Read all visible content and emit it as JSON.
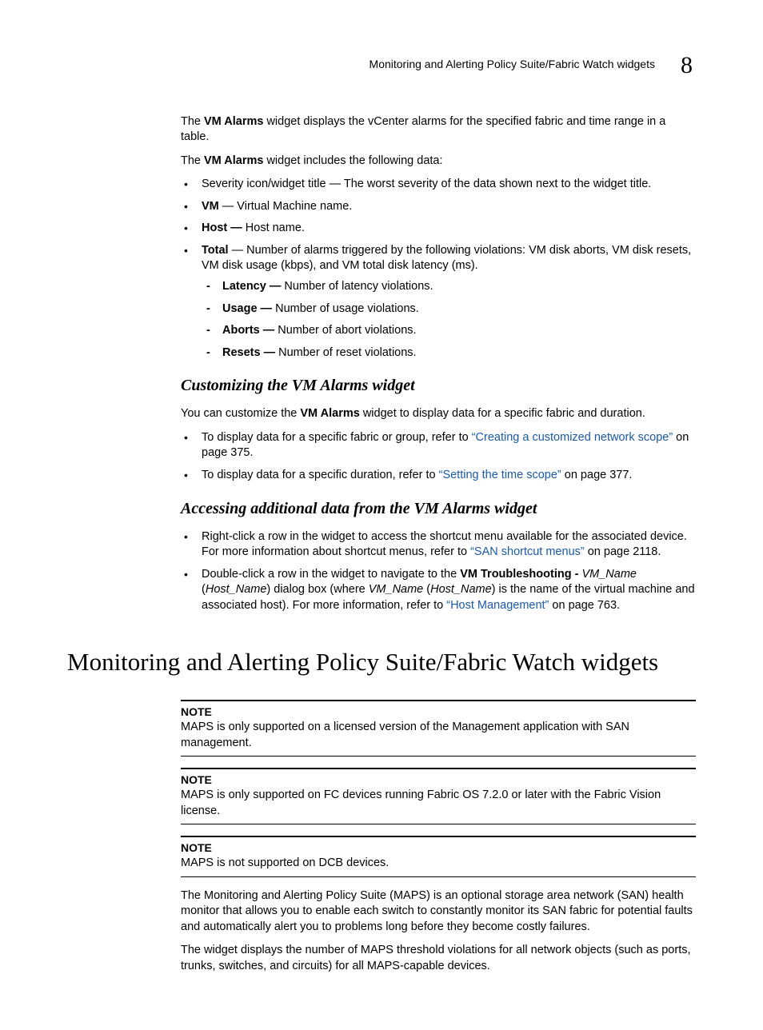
{
  "header": {
    "running_title": "Monitoring and Alerting Policy Suite/Fabric Watch widgets",
    "chapter_number": "8"
  },
  "intro": {
    "p1_pre": "The ",
    "p1_bold": "VM Alarms",
    "p1_post": " widget displays the vCenter alarms for the specified fabric and time range in a table.",
    "p2_pre": "The ",
    "p2_bold": "VM Alarms",
    "p2_post": " widget includes the following data:"
  },
  "data_list": {
    "severity": "Severity icon/widget title — The worst severity of the data shown next to the widget title.",
    "vm_bold": "VM",
    "vm_rest": " — Virtual Machine name.",
    "host_bold": "Host —",
    "host_rest": " Host name.",
    "total_bold": "Total",
    "total_rest": " — Number of alarms triggered by the following violations: VM disk aborts, VM disk resets, VM disk usage (kbps), and VM total disk latency (ms).",
    "sub": {
      "latency_bold": "Latency —",
      "latency_rest": " Number of latency violations.",
      "usage_bold": "Usage —",
      "usage_rest": " Number of usage violations.",
      "aborts_bold": "Aborts —",
      "aborts_rest": " Number of abort violations.",
      "resets_bold": "Resets —",
      "resets_rest": " Number of reset violations."
    }
  },
  "customizing": {
    "heading": "Customizing the VM Alarms widget",
    "intro_pre": "You can customize the ",
    "intro_bold": "VM Alarms",
    "intro_post": " widget to display data for a specific fabric and duration.",
    "b1_pre": "To display data for a specific fabric or group, refer to ",
    "b1_link": "“Creating a customized network scope”",
    "b1_post": " on page 375.",
    "b2_pre": "To display data for a specific duration, refer to ",
    "b2_link": "“Setting the time scope”",
    "b2_post": " on page 377."
  },
  "accessing": {
    "heading": "Accessing additional data from the VM Alarms widget",
    "b1_pre": "Right-click a row in the widget to access the shortcut menu available for the associated device. For more information about shortcut menus, refer to ",
    "b1_link": "“SAN shortcut menus”",
    "b1_post": " on page 2118.",
    "b2_a": "Double-click a row in the widget to navigate to the ",
    "b2_bold": "VM Troubleshooting - ",
    "b2_it1": "VM_Name",
    "b2_b": " (",
    "b2_it2": "Host_Name",
    "b2_c": ") dialog box (where ",
    "b2_it3": "VM_Name",
    "b2_d": " (",
    "b2_it4": "Host_Name",
    "b2_e": ") is the name of the virtual machine and associated host). For more information, refer to ",
    "b2_link": "“Host Management”",
    "b2_f": " on page 763."
  },
  "h1": "Monitoring and Alerting Policy Suite/Fabric Watch widgets",
  "notes": {
    "label": "NOTE",
    "n1": "MAPS is only supported on a licensed version of the Management application with SAN management.",
    "n2": "MAPS is only supported on FC devices running Fabric OS 7.2.0 or later with the Fabric Vision license.",
    "n3": "MAPS is not supported on DCB devices."
  },
  "maps_body": {
    "p1": "The Monitoring and Alerting Policy Suite (MAPS) is an optional storage area network (SAN) health monitor that allows you to enable each switch to constantly monitor its SAN fabric for potential faults and automatically alert you to problems long before they become costly failures.",
    "p2": "The widget displays the number of MAPS threshold violations for all network objects (such as ports, trunks, switches, and circuits) for all MAPS-capable devices."
  }
}
